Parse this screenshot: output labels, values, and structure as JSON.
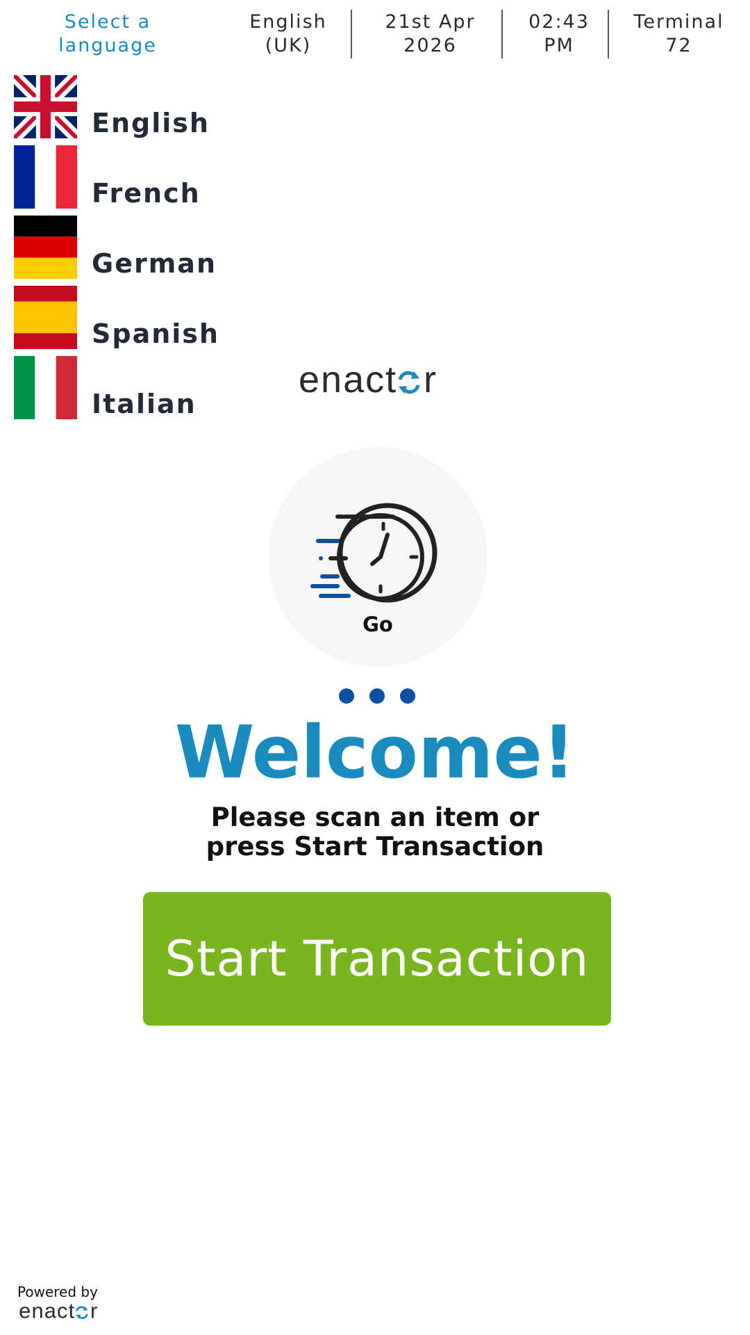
{
  "header": {
    "select_language": [
      "Select a",
      "language"
    ],
    "current_language": [
      "English",
      "(UK)"
    ],
    "date": [
      "21st Apr",
      "2026"
    ],
    "time": [
      "02:43",
      "PM"
    ],
    "terminal": [
      "Terminal",
      "72"
    ]
  },
  "languages": [
    {
      "label": "English",
      "flag_icon": "uk-flag-icon"
    },
    {
      "label": "French",
      "flag_icon": "france-flag-icon"
    },
    {
      "label": "German",
      "flag_icon": "germany-flag-icon"
    },
    {
      "label": "Spanish",
      "flag_icon": "spain-flag-icon"
    },
    {
      "label": "Italian",
      "flag_icon": "italy-flag-icon"
    }
  ],
  "logo": {
    "text": "enactor"
  },
  "go": {
    "label": "Go",
    "icon": "fast-clock-icon"
  },
  "welcome": {
    "title": "Welcome!",
    "instruction_line1": "Please scan an item or",
    "instruction_line2": "press Start Transaction"
  },
  "start_button": {
    "label": "Start Transaction"
  },
  "footer": {
    "powered_by": "Powered by",
    "logo_text": "enactor"
  },
  "colors": {
    "accent_blue": "#1a8bbf",
    "dot_blue": "#0d4fa0",
    "button_green": "#7ab51f",
    "text_dark": "#232a38"
  }
}
